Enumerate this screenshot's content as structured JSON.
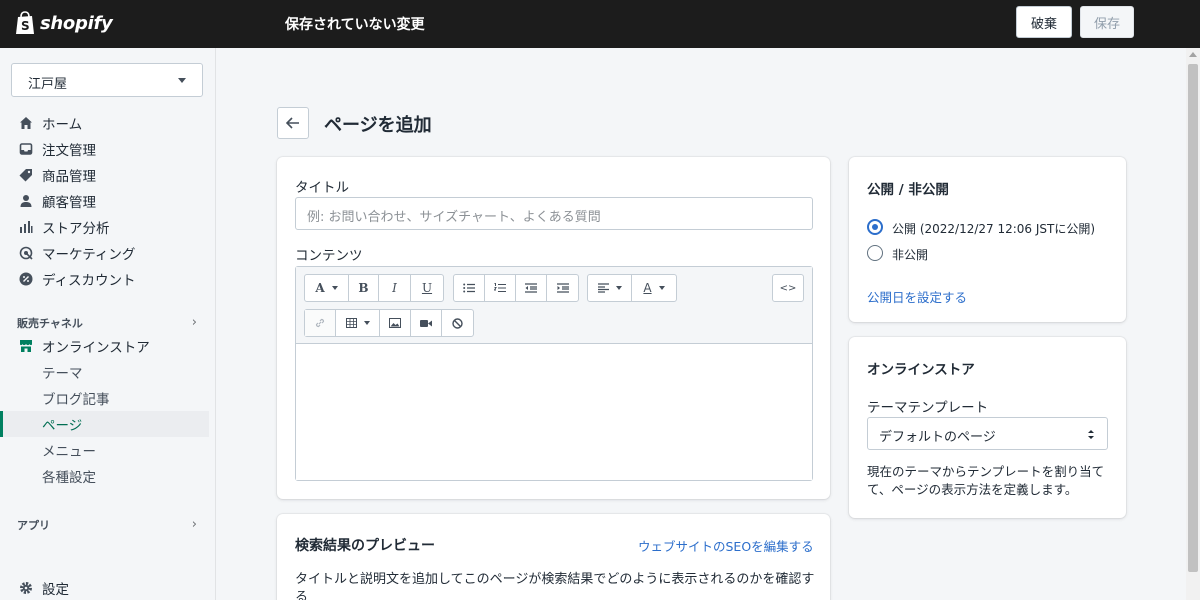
{
  "topbar": {
    "logo_text": "shopify",
    "title": "保存されていない変更",
    "discard_label": "破棄",
    "save_label": "保存"
  },
  "sidebar": {
    "store_name": "江戸屋",
    "items": [
      {
        "label": "ホーム",
        "icon": "home-icon"
      },
      {
        "label": "注文管理",
        "icon": "inbox-icon"
      },
      {
        "label": "商品管理",
        "icon": "tag-icon"
      },
      {
        "label": "顧客管理",
        "icon": "person-icon"
      },
      {
        "label": "ストア分析",
        "icon": "bar-chart-icon"
      },
      {
        "label": "マーケティング",
        "icon": "target-icon"
      },
      {
        "label": "ディスカウント",
        "icon": "discount-icon"
      }
    ],
    "sales_channels_label": "販売チャネル",
    "online_store_label": "オンラインストア",
    "subitems": [
      "テーマ",
      "ブログ記事",
      "ページ",
      "メニュー",
      "各種設定"
    ],
    "active_subitem": "ページ",
    "apps_label": "アプリ",
    "settings_label": "設定"
  },
  "main": {
    "page_title": "ページを追加",
    "title_label": "タイトル",
    "title_placeholder": "例: お問い合わせ、サイズチャート、よくある質問",
    "content_label": "コンテンツ",
    "toolbar": {
      "font_button": "A",
      "bold_button": "B",
      "italic_button": "I",
      "underline_button": "U",
      "color_button": "A",
      "html_button": "<>"
    },
    "seo": {
      "heading": "検索結果のプレビュー",
      "edit_link": "ウェブサイトのSEOを編集する",
      "description": "タイトルと説明文を追加してこのページが検索結果でどのように表示されるのかを確認する"
    }
  },
  "visibility": {
    "heading": "公開 / 非公開",
    "option_published": "公開 (2022/12/27 12:06 JSTに公開)",
    "option_hidden": "非公開",
    "selected": "published",
    "set_date_link": "公開日を設定する"
  },
  "online_store": {
    "heading": "オンラインストア",
    "template_label": "テーマテンプレート",
    "template_value": "デフォルトのページ",
    "help_text": "現在のテーマからテンプレートを割り当てて、ページの表示方法を定義します。"
  },
  "colors": {
    "topbar": "#1c1c1c",
    "accent": "#2c6ecb",
    "active_nav": "#008060"
  }
}
